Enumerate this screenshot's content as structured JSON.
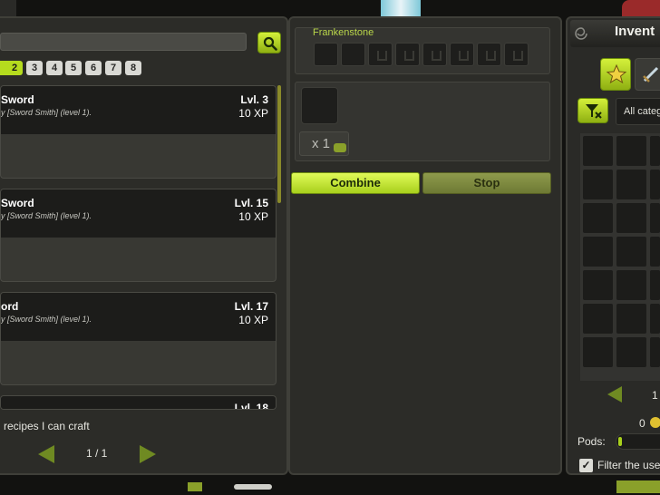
{
  "colors": {
    "accent": "#b5dc1e",
    "panel": "#2c2c28",
    "dark": "#1c1c1a"
  },
  "recipes": {
    "search_value": "",
    "pages": [
      "2",
      "3",
      "4",
      "5",
      "6",
      "7",
      "8"
    ],
    "items": [
      {
        "name": "Sword",
        "description": "y [Sword Smith] (level 1).",
        "level": "Lvl. 3",
        "xp": "10 XP"
      },
      {
        "name": "Sword",
        "description": "y [Sword Smith] (level 1).",
        "level": "Lvl. 15",
        "xp": "10 XP"
      },
      {
        "name": "ord",
        "description": "y [Sword Smith] (level 1).",
        "level": "Lvl. 17",
        "xp": "10 XP"
      },
      {
        "name": "",
        "description": "",
        "level": "Lvl. 18",
        "xp": ""
      }
    ],
    "craftable_filter_label": "recipes I can craft",
    "pager": "1 / 1"
  },
  "crafting": {
    "ingredient_title": "Frankenstone",
    "quantity": "x 1",
    "combine_label": "Combine",
    "stop_label": "Stop"
  },
  "inventory": {
    "title": "Invent",
    "category": "All categ",
    "page": "1",
    "kamas": "0",
    "pods_label": "Pods:",
    "pods_fraction": 0.02,
    "filter_label": "Filter the use",
    "filter_checked": true
  },
  "icons": [
    "search-icon",
    "star-icon",
    "sword-icon",
    "filter-icon",
    "arrow-left-icon",
    "arrow-right-icon",
    "kamas-coin-icon",
    "check-icon"
  ]
}
